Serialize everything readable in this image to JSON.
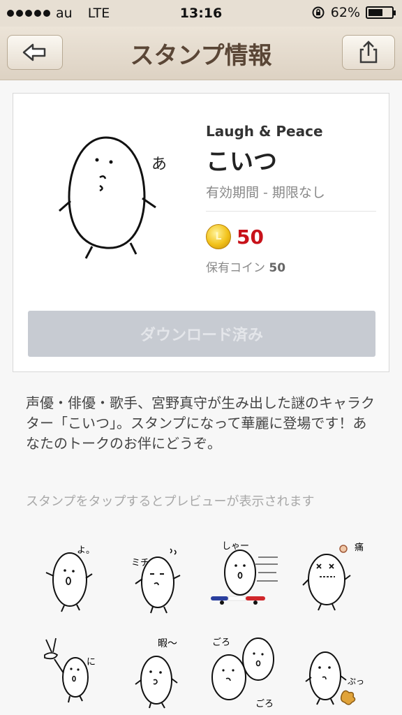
{
  "status": {
    "carrier": "au",
    "network": "LTE",
    "time": "13:16",
    "battery": "62%",
    "battery_level": 0.62
  },
  "nav": {
    "title": "スタンプ情報",
    "back_icon": "back-arrow-icon",
    "share_icon": "share-icon"
  },
  "sticker": {
    "publisher": "Laugh & Peace",
    "name": "こいつ",
    "validity": "有効期間 - 期限なし",
    "coin_mark": "L",
    "price": "50",
    "owned_label": "保有コイン",
    "owned_value": "50",
    "button_label": "ダウンロード済み",
    "main_caption": "あ"
  },
  "description": "声優・俳優・歌手、宮野真守が生み出した謎のキャラクター「こいつ」。スタンプになって華麗に登場です！あなたのトークのお伴にどうぞ。",
  "hint": "スタンプをタップするとプレビューが表示されます",
  "stickers_captions": [
    "よ。",
    "ミチ",
    "しゃー",
    "痛",
    "に",
    "暇〜",
    "ごろ",
    "ぷっ"
  ],
  "colors": {
    "price": "#c8121a",
    "nav_title": "#5a4636",
    "button_disabled": "#c7cbd2"
  }
}
